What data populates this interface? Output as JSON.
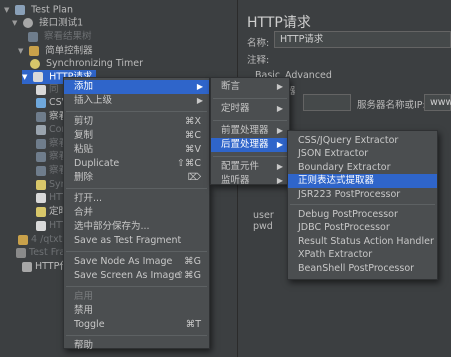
{
  "tree": {
    "test_plan": "Test Plan",
    "thread_group": "接口测试1",
    "view_results": "察看结果树",
    "simple_controller": "简单控制器",
    "sync_timer": "Synchronizing Timer",
    "http_request": "HTTP请求",
    "partial_rows": [
      {
        "label": "同",
        "dim": true
      },
      {
        "label": "CSV",
        "dim": false
      },
      {
        "label": "察看",
        "dim": false
      },
      {
        "label": "Con",
        "dim": true
      },
      {
        "label": "察看",
        "dim": true
      },
      {
        "label": "察看",
        "dim": true
      },
      {
        "label": "察看",
        "dim": true
      },
      {
        "label": "Sync",
        "dim": true
      },
      {
        "label": "HTTP",
        "dim": true
      },
      {
        "label": "定时器",
        "dim": false
      },
      {
        "label": "HTTP",
        "dim": true
      },
      {
        "label": "4 /qtxt",
        "dim": true
      },
      {
        "label": "Test Fra",
        "dim": true
      },
      {
        "label": "HTTP代",
        "dim": false
      }
    ]
  },
  "right_panel": {
    "title": "HTTP请求",
    "name_label": "名称:",
    "name_value": "HTTP请求",
    "comment_label": "注释:",
    "tab_basic": "Basic",
    "tab_advanced": "Advanced",
    "protocol_fragment": "器",
    "server_label": "服务器名称或IP:",
    "server_value": "www.",
    "user_label": "user",
    "pwd_label": "pwd"
  },
  "context_menu": {
    "items": [
      {
        "label": "添加",
        "submenu": true,
        "highlighted": true
      },
      {
        "label": "插入上级",
        "submenu": true
      },
      {
        "sep": true
      },
      {
        "label": "剪切",
        "shortcut": "⌘X"
      },
      {
        "label": "复制",
        "shortcut": "⌘C"
      },
      {
        "label": "粘贴",
        "shortcut": "⌘V"
      },
      {
        "label": "Duplicate",
        "shortcut": "⇧⌘C"
      },
      {
        "label": "删除",
        "shortcut": "⌦"
      },
      {
        "sep": true
      },
      {
        "label": "打开..."
      },
      {
        "label": "合并"
      },
      {
        "label": "选中部分保存为..."
      },
      {
        "label": "Save as Test Fragment"
      },
      {
        "sep": true
      },
      {
        "label": "Save Node As Image",
        "shortcut": "⌘G"
      },
      {
        "label": "Save Screen As Image",
        "shortcut": "⇧⌘G"
      },
      {
        "sep": true
      },
      {
        "label": "启用",
        "disabled": true
      },
      {
        "label": "禁用"
      },
      {
        "label": "Toggle",
        "shortcut": "⌘T"
      },
      {
        "sep": true
      },
      {
        "label": "帮助"
      }
    ]
  },
  "add_menu": {
    "items": [
      {
        "label": "断言",
        "submenu": true
      },
      {
        "sep": true
      },
      {
        "label": "定时器",
        "submenu": true
      },
      {
        "sep": true
      },
      {
        "label": "前置处理器",
        "submenu": true
      },
      {
        "label": "后置处理器",
        "submenu": true,
        "highlighted": true
      },
      {
        "sep": true
      },
      {
        "label": "配置元件",
        "submenu": true
      },
      {
        "label": "监听器",
        "submenu": true
      }
    ]
  },
  "post_processor_menu": {
    "items": [
      {
        "label": "CSS/JQuery Extractor"
      },
      {
        "label": "JSON Extractor"
      },
      {
        "label": "Boundary Extractor"
      },
      {
        "label": "正则表达式提取器",
        "highlighted": true
      },
      {
        "label": "JSR223 PostProcessor"
      },
      {
        "sep": true
      },
      {
        "label": "Debug PostProcessor"
      },
      {
        "label": "JDBC PostProcessor"
      },
      {
        "label": "Result Status Action Handler"
      },
      {
        "label": "XPath Extractor"
      },
      {
        "label": "BeanShell PostProcessor"
      }
    ]
  },
  "colors": {
    "background": "#3c3f41",
    "menu_background": "#4b4e50",
    "highlight": "#2f65ca",
    "text": "#c8c8c8",
    "disabled_text": "#7b7e80"
  }
}
